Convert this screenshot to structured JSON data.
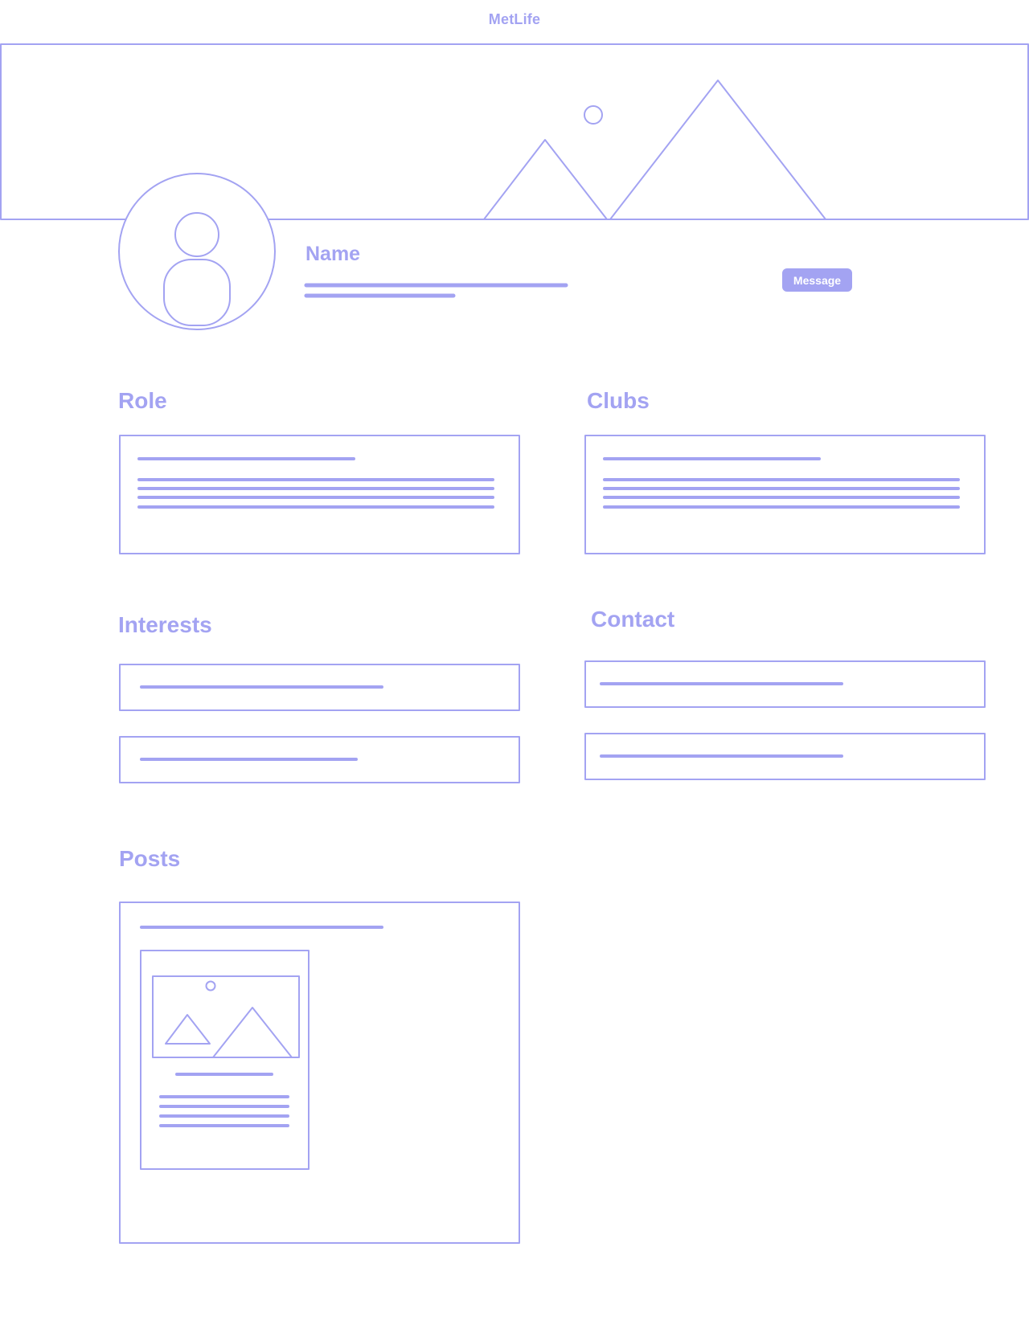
{
  "header": {
    "brand": "MetLife"
  },
  "profile": {
    "name_label": "Name",
    "message_button_label": "Message"
  },
  "sections": {
    "role": "Role",
    "clubs": "Clubs",
    "interests": "Interests",
    "contact": "Contact",
    "posts": "Posts"
  },
  "icons": {
    "cover": "image-placeholder-icon",
    "avatar": "user-avatar-icon",
    "post_image": "image-placeholder-icon"
  },
  "colors": {
    "accent": "#a3a3f2",
    "background": "#ffffff"
  }
}
